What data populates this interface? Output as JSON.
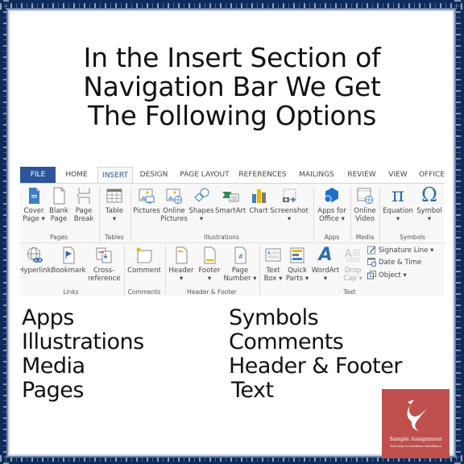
{
  "headline": {
    "line1": "In the Insert Section of",
    "line2": "Navigation Bar We Get",
    "line3": "The Following Options"
  },
  "ribbon": {
    "tabs": [
      "FILE",
      "HOME",
      "INSERT",
      "DESIGN",
      "PAGE LAYOUT",
      "REFERENCES",
      "MAILINGS",
      "REVIEW",
      "VIEW",
      "OFFICE"
    ],
    "active_tab": "INSERT",
    "row1": {
      "groups": [
        {
          "name": "Pages",
          "buttons": [
            {
              "label1": "Cover",
              "label2": "Page ▾",
              "icon": "cover-page-icon"
            },
            {
              "label1": "Blank",
              "label2": "Page",
              "icon": "blank-page-icon"
            },
            {
              "label1": "Page",
              "label2": "Break",
              "icon": "page-break-icon"
            }
          ]
        },
        {
          "name": "Tables",
          "buttons": [
            {
              "label1": "Table",
              "label2": "▾",
              "icon": "table-icon"
            }
          ]
        },
        {
          "name": "Illustrations",
          "buttons": [
            {
              "label1": "Pictures",
              "label2": "",
              "icon": "pictures-icon"
            },
            {
              "label1": "Online",
              "label2": "Pictures",
              "icon": "online-pictures-icon"
            },
            {
              "label1": "Shapes",
              "label2": "▾",
              "icon": "shapes-icon"
            },
            {
              "label1": "SmartArt",
              "label2": "",
              "icon": "smartart-icon"
            },
            {
              "label1": "Chart",
              "label2": "",
              "icon": "chart-icon"
            },
            {
              "label1": "Screenshot",
              "label2": "▾",
              "icon": "screenshot-icon"
            }
          ]
        },
        {
          "name": "Apps",
          "buttons": [
            {
              "label1": "Apps for",
              "label2": "Office ▾",
              "icon": "apps-for-office-icon"
            }
          ]
        },
        {
          "name": "Media",
          "buttons": [
            {
              "label1": "Online",
              "label2": "Video",
              "icon": "online-video-icon"
            }
          ]
        },
        {
          "name": "Symbols",
          "buttons": [
            {
              "label1": "Equation",
              "label2": "▾",
              "icon": "equation-icon",
              "glyph": "π"
            },
            {
              "label1": "Symbol",
              "label2": "▾",
              "icon": "symbol-icon",
              "glyph": "Ω"
            }
          ]
        }
      ]
    },
    "row2": {
      "groups": [
        {
          "name": "Links",
          "buttons": [
            {
              "label1": "Hyperlink",
              "label2": "",
              "icon": "hyperlink-icon"
            },
            {
              "label1": "Bookmark",
              "label2": "",
              "icon": "bookmark-icon"
            },
            {
              "label1": "Cross-",
              "label2": "reference",
              "icon": "cross-reference-icon"
            }
          ]
        },
        {
          "name": "Comments",
          "buttons": [
            {
              "label1": "Comment",
              "label2": "",
              "icon": "comment-icon"
            }
          ]
        },
        {
          "name": "Header & Footer",
          "buttons": [
            {
              "label1": "Header",
              "label2": "▾",
              "icon": "header-icon"
            },
            {
              "label1": "Footer",
              "label2": "▾",
              "icon": "footer-icon"
            },
            {
              "label1": "Page",
              "label2": "Number ▾",
              "icon": "page-number-icon"
            }
          ]
        },
        {
          "name": "Text",
          "buttons": [
            {
              "label1": "Text",
              "label2": "Box ▾",
              "icon": "text-box-icon"
            },
            {
              "label1": "Quick",
              "label2": "Parts ▾",
              "icon": "quick-parts-icon"
            },
            {
              "label1": "WordArt",
              "label2": "▾",
              "icon": "wordart-icon"
            },
            {
              "label1": "Drop",
              "label2": "Cap ▾",
              "icon": "drop-cap-icon"
            }
          ],
          "small_buttons": [
            {
              "label": "Signature Line ▾",
              "icon": "signature-line-icon"
            },
            {
              "label": "Date & Time",
              "icon": "date-time-icon"
            },
            {
              "label": "Object ▾",
              "icon": "object-icon"
            }
          ]
        }
      ]
    }
  },
  "lists": {
    "left": [
      "Apps",
      "Illustrations",
      "Media",
      "Pages"
    ],
    "right": [
      "Symbols",
      "Comments",
      "Header & Footer",
      "Text"
    ]
  },
  "logo": {
    "name": "Sample Assignment",
    "tagline": "Your Key to Academic Excellence"
  },
  "colors": {
    "frame": "#0f2b5c",
    "file_tab": "#2b579a",
    "office_blue": "#2b579a",
    "logo_bg": "#c0504d"
  }
}
